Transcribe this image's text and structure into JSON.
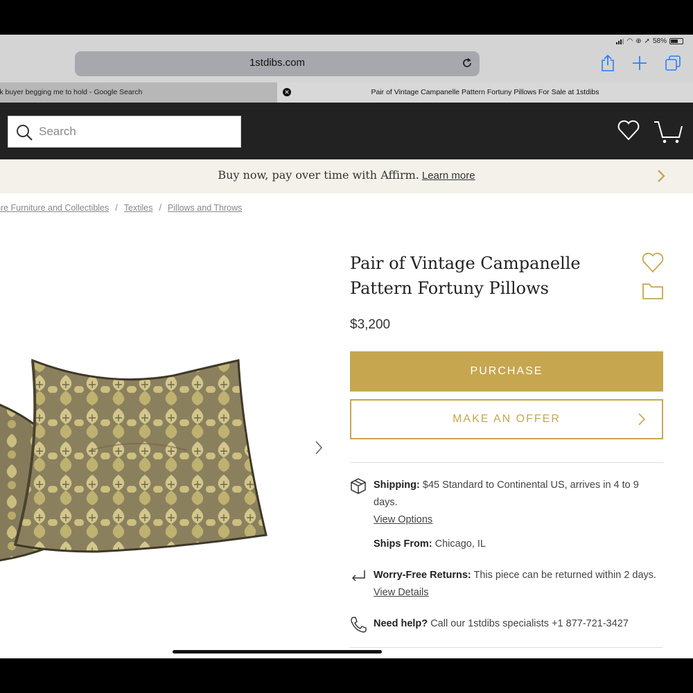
{
  "status_bar": {
    "battery": "58%"
  },
  "browser": {
    "url": "1stdibs.com",
    "tabs": [
      {
        "title": "ark buyer begging me to hold - Google Search",
        "active": false
      },
      {
        "title": "Pair of Vintage Campanelle Pattern Fortuny Pillows For Sale at 1stdibs",
        "active": true
      }
    ]
  },
  "header": {
    "search_placeholder": "Search"
  },
  "affirm": {
    "text": "Buy now, pay over time with Affirm.",
    "link": "Learn more"
  },
  "breadcrumbs": [
    "ore Furniture and Collectibles",
    "Textiles",
    "Pillows and Throws"
  ],
  "product": {
    "title_line1": "Pair of Vintage Campanelle",
    "title_line2": "Pattern Fortuny Pillows",
    "price": "$3,200",
    "purchase_label": "PURCHASE",
    "offer_label": "MAKE AN OFFER"
  },
  "shipping": {
    "label": "Shipping:",
    "text": "$45 Standard to Continental US, arrives in 4 to 9 days.",
    "link": "View Options"
  },
  "ships_from": {
    "label": "Ships From:",
    "text": "Chicago, IL"
  },
  "returns": {
    "label": "Worry-Free Returns:",
    "text": "This piece can be returned within 2 days.",
    "link": "View Details"
  },
  "help": {
    "label": "Need help?",
    "text": "Call our 1stdibs specialists +1 877-721-3427"
  },
  "colors": {
    "gold": "#c6a64f",
    "header_bg": "#222222",
    "banner_bg": "#f4f1ea"
  }
}
